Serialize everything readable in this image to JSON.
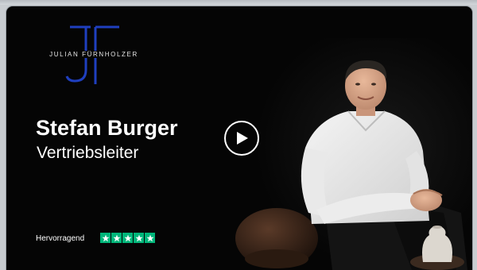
{
  "logo": {
    "monogram": "JF",
    "name": "JULIAN FÜRNHOLZER"
  },
  "speaker": {
    "name": "Stefan Burger",
    "role": "Vertriebsleiter"
  },
  "rating": {
    "label": "Hervorragend",
    "stars": 5,
    "star_color": "#00b67a"
  },
  "play_button": {
    "icon": "play-icon"
  },
  "colors": {
    "background": "#050505",
    "logo_blue": "#1f3fbf",
    "text": "#ffffff"
  }
}
